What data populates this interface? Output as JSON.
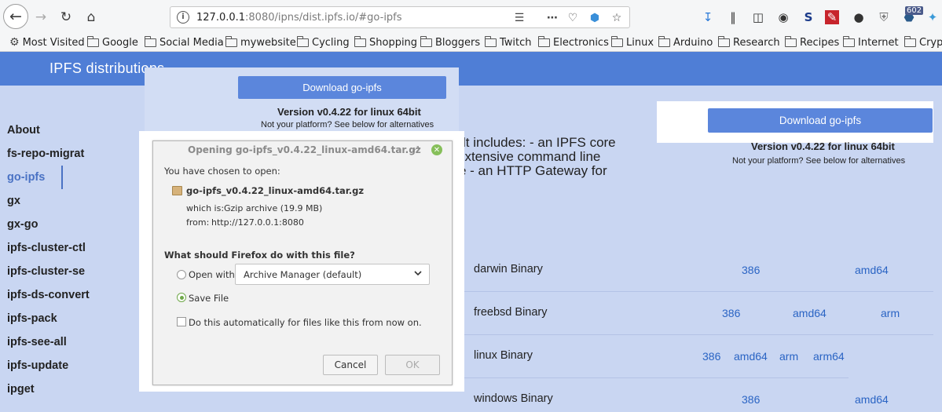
{
  "browser": {
    "url_host": "127.0.0.1",
    "url_rest": ":8080/ipns/dist.ipfs.io/#go-ipfs",
    "extension_badge": "602",
    "bookmarks": [
      "Most Visited",
      "Google",
      "Social Media",
      "mywebsite",
      "Cycling",
      "Shopping",
      "Bloggers",
      "Twitch",
      "Electronics",
      "Linux",
      "Arduino",
      "Research",
      "Recipes",
      "Internet",
      "Crypt"
    ]
  },
  "page": {
    "site_title": "IPFS distributions",
    "sidebar": [
      "About",
      "fs-repo-migrat",
      "go-ipfs",
      "gx",
      "gx-go",
      "ipfs-cluster-ctl",
      "ipfs-cluster-se",
      "ipfs-ds-convert",
      "ipfs-pack",
      "ipfs-see-all",
      "ipfs-update",
      "ipget"
    ],
    "active_item": "go-ipfs",
    "download_button": "Download go-ipfs",
    "version_title": "Version v0.4.22 for linux 64bit",
    "version_sub": "Not your platform? See below for alternatives",
    "description_lines": [
      "lt includes: - an IPFS core",
      "extensive command line",
      "e - an HTTP Gateway for"
    ],
    "platforms": [
      {
        "name": "darwin Binary",
        "archs": [
          "386",
          "amd64"
        ]
      },
      {
        "name": "freebsd Binary",
        "archs": [
          "386",
          "amd64",
          "arm"
        ]
      },
      {
        "name": "linux Binary",
        "archs": [
          "386",
          "amd64",
          "arm",
          "arm64"
        ]
      },
      {
        "name": "windows Binary",
        "archs": [
          "386",
          "amd64"
        ]
      }
    ]
  },
  "dialog": {
    "title": "Opening go-ipfs_v0.4.22_linux-amd64.tar.gz",
    "chosen_label": "You have chosen to open:",
    "filename": "go-ipfs_v0.4.22_linux-amd64.tar.gz",
    "which_is_label": "which is:",
    "which_is_value": "Gzip archive (19.9 MB)",
    "from_label": "from:",
    "from_value": "http://127.0.0.1:8080",
    "question": "What should Firefox do with this file?",
    "open_with_label": "Open with",
    "open_with_app": "Archive Manager (default)",
    "save_file_label": "Save File",
    "auto_label": "Do this automatically for files like this from now on.",
    "selected_option": "Save File",
    "cancel": "Cancel",
    "ok": "OK"
  }
}
